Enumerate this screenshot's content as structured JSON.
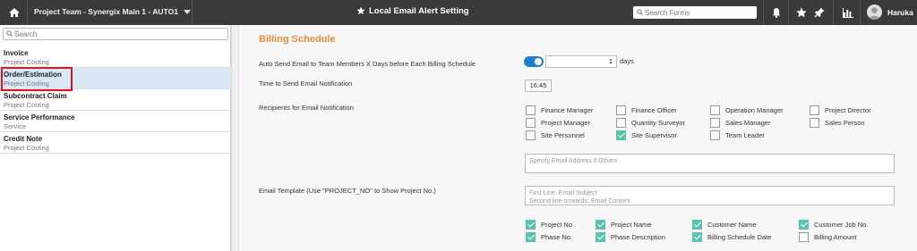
{
  "topbar": {
    "project_label": "Project Team - Synergix Main 1 - AUTO1",
    "page_title": "Local Email Alert Setting",
    "search_placeholder": "Search Forms",
    "user_name": "Haruka",
    "icons": [
      "home-icon",
      "star-icon",
      "bell-icon",
      "star-icon",
      "pin-icon",
      "chart-icon"
    ]
  },
  "sidebar": {
    "search_placeholder": "Search",
    "items": [
      {
        "title": "Invoice",
        "subtitle": "Project Costing"
      },
      {
        "title": "Order/Estimation",
        "subtitle": "Project Costing"
      },
      {
        "title": "Subcontract Claim",
        "subtitle": "Project Costing"
      },
      {
        "title": "Service Performance",
        "subtitle": "Service"
      },
      {
        "title": "Credit Note",
        "subtitle": "Project Costing"
      }
    ],
    "active_index": 1
  },
  "main": {
    "section_title": "Billing Schedule",
    "auto_send_label": "Auto Send Email to Team Members X Days before Each Billing Schedule",
    "auto_send_enabled": true,
    "days_value": "1",
    "days_unit": "days",
    "time_label": "Time to Send Email Notification",
    "time_value": "16:45",
    "recipients_label": "Recipients for Email Notification",
    "recipients": [
      {
        "label": "Finance Manager",
        "checked": false
      },
      {
        "label": "Finance Officer",
        "checked": false
      },
      {
        "label": "Operation Manager",
        "checked": false
      },
      {
        "label": "Project Director",
        "checked": false
      },
      {
        "label": "Project Manager",
        "checked": false
      },
      {
        "label": "Quantity Surveyor",
        "checked": false
      },
      {
        "label": "Sales Manager",
        "checked": false
      },
      {
        "label": "Sales Person",
        "checked": false
      },
      {
        "label": "Site Personnel",
        "checked": false
      },
      {
        "label": "Site Supervisor",
        "checked": true
      },
      {
        "label": "Team Leader",
        "checked": false
      }
    ],
    "other_email_placeholder": "Specify Email Address if Others",
    "template_label": "Email Template (Use \"PROJECT_NO\" to Show Project No.)",
    "template_placeholder_line1": "First Line: Email Subject",
    "template_placeholder_line2": "Second line onwards: Email Content",
    "fields": [
      {
        "label": "Project No.",
        "checked": true
      },
      {
        "label": "Project Name",
        "checked": true
      },
      {
        "label": "Customer Name",
        "checked": true
      },
      {
        "label": "Customer Job No.",
        "checked": true
      },
      {
        "label": "Phase No.",
        "checked": true
      },
      {
        "label": "Phase Description",
        "checked": true
      },
      {
        "label": "Billing Schedule Date",
        "checked": true
      },
      {
        "label": "Billing Amount",
        "checked": false
      }
    ]
  },
  "colors": {
    "accent": "#f28b3c",
    "toggle": "#1f7fd1",
    "check": "#5bc2b0",
    "highlight": "#e0141e"
  }
}
